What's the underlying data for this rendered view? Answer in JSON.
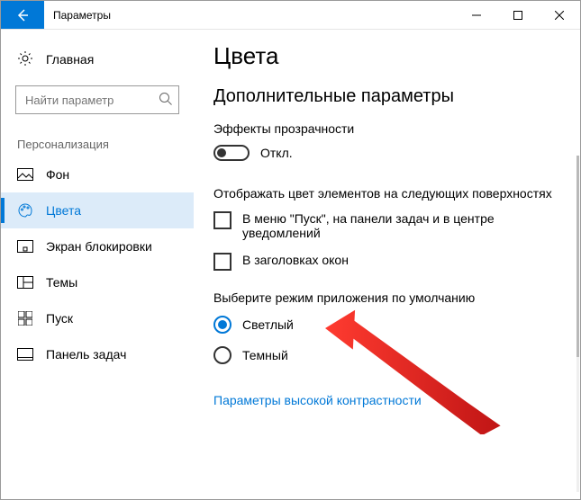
{
  "titlebar": {
    "title": "Параметры"
  },
  "sidebar": {
    "home": "Главная",
    "search_placeholder": "Найти параметр",
    "section": "Персонализация",
    "items": [
      {
        "label": "Фон"
      },
      {
        "label": "Цвета"
      },
      {
        "label": "Экран блокировки"
      },
      {
        "label": "Темы"
      },
      {
        "label": "Пуск"
      },
      {
        "label": "Панель задач"
      }
    ]
  },
  "content": {
    "heading": "Цвета",
    "subheading": "Дополнительные параметры",
    "transparency": {
      "label": "Эффекты прозрачности",
      "state": "Откл."
    },
    "surfaces": {
      "title": "Отображать цвет элементов на следующих поверхностях",
      "opts": [
        "В меню \"Пуск\", на панели задач и в центре уведомлений",
        "В заголовках окон"
      ]
    },
    "mode": {
      "title": "Выберите режим приложения по умолчанию",
      "opts": [
        "Светлый",
        "Темный"
      ]
    },
    "hc_link": "Параметры высокой контрастности"
  }
}
